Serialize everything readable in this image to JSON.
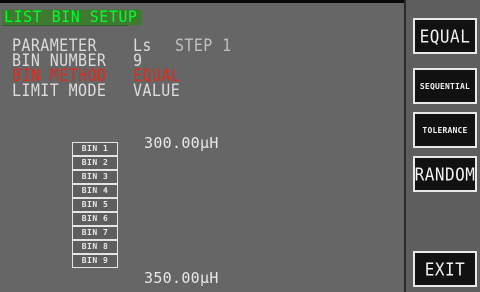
{
  "title": "LIST BIN SETUP",
  "params": [
    {
      "label": "PARAMETER",
      "value": "Ls",
      "extra": "STEP 1"
    },
    {
      "label": "BIN NUMBER",
      "value": "9"
    },
    {
      "label": "BIN METHOD",
      "value": "EQUAL"
    },
    {
      "label": "LIMIT MODE",
      "value": "VALUE"
    }
  ],
  "range": {
    "high": "300.00μH",
    "low": "350.00μH"
  },
  "bins": [
    "BIN 1",
    "BIN 2",
    "BIN 3",
    "BIN 4",
    "BIN 5",
    "BIN 6",
    "BIN 7",
    "BIN 8",
    "BIN 9"
  ],
  "softkeys": {
    "equal": "EQUAL",
    "sequential": "SEQUENTIAL",
    "tolerance": "TOLERANCE",
    "random": "RANDOM",
    "exit": "EXIT"
  },
  "colors": {
    "title": "#00ff2a",
    "highlight": "#e02a1a",
    "background": "#666666"
  }
}
